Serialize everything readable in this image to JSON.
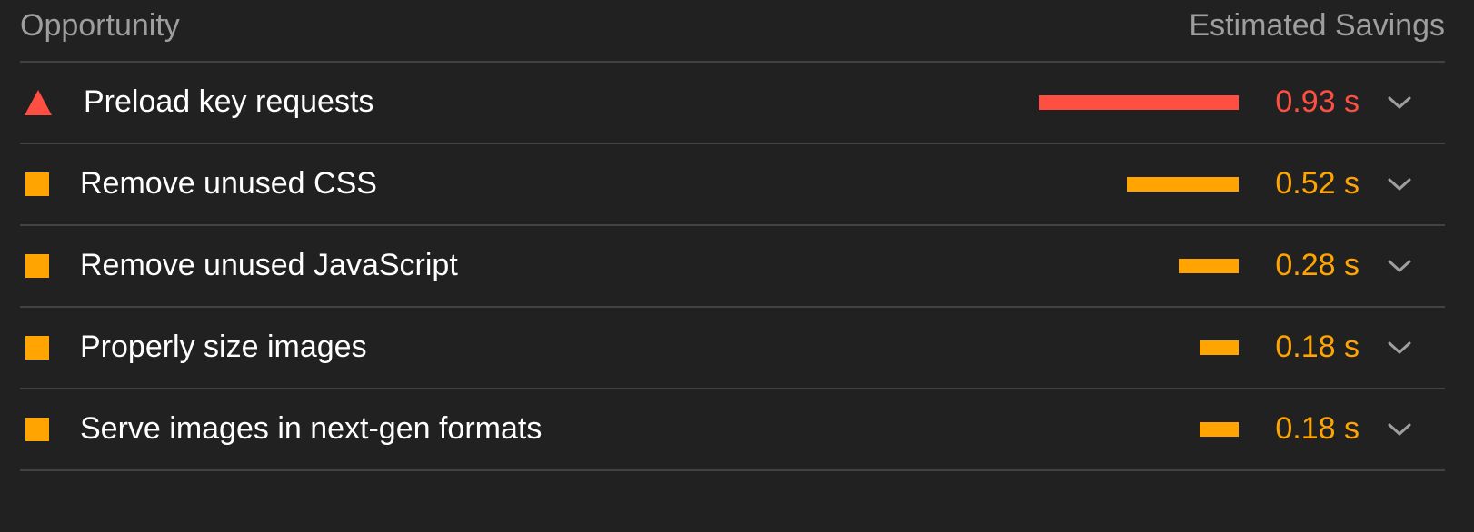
{
  "header": {
    "left_label": "Opportunity",
    "right_label": "Estimated Savings"
  },
  "colors": {
    "fail": "#ff4e42",
    "average": "#ffa400",
    "background": "#212121",
    "divider": "#424242"
  },
  "max_savings_s": 0.93,
  "opportunities": [
    {
      "title": "Preload key requests",
      "savings": "0.93 s",
      "savings_s": 0.93,
      "status": "fail",
      "icon": "triangle-fail-icon"
    },
    {
      "title": "Remove unused CSS",
      "savings": "0.52 s",
      "savings_s": 0.52,
      "status": "average",
      "icon": "square-average-icon"
    },
    {
      "title": "Remove unused JavaScript",
      "savings": "0.28 s",
      "savings_s": 0.28,
      "status": "average",
      "icon": "square-average-icon"
    },
    {
      "title": "Properly size images",
      "savings": "0.18 s",
      "savings_s": 0.18,
      "status": "average",
      "icon": "square-average-icon"
    },
    {
      "title": "Serve images in next-gen formats",
      "savings": "0.18 s",
      "savings_s": 0.18,
      "status": "average",
      "icon": "square-average-icon"
    }
  ]
}
